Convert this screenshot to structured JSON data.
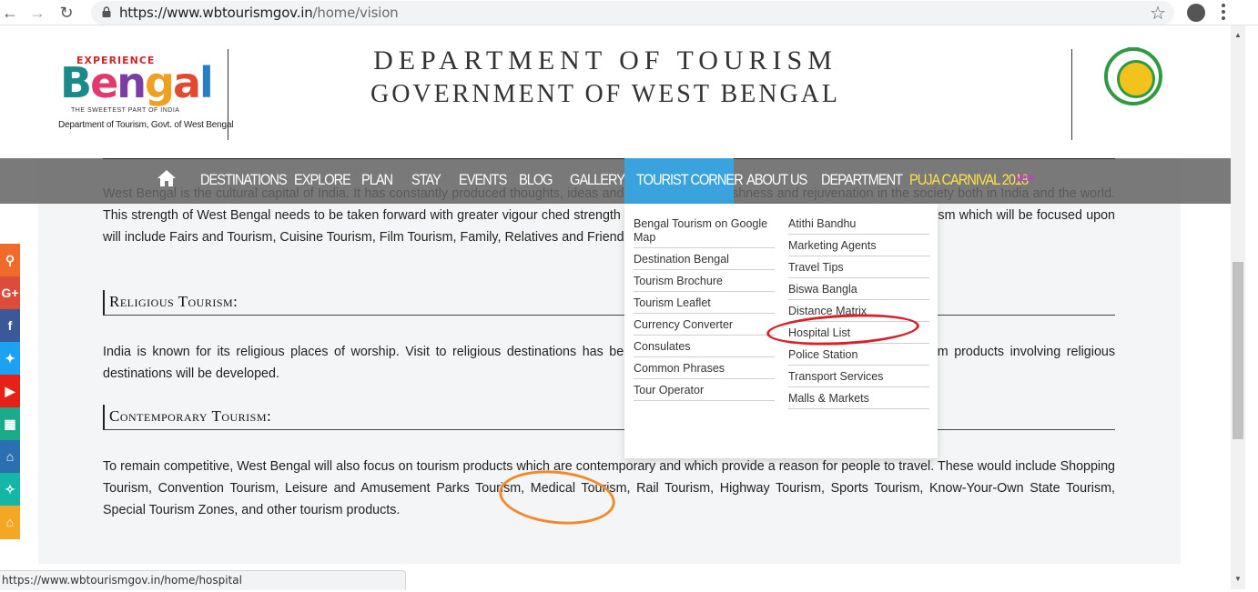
{
  "browser": {
    "url_host": "https://www.wbtourismgov.in",
    "url_path": "/home/vision",
    "status_url": "https://www.wbtourismgov.in/home/hospital"
  },
  "header": {
    "logo": {
      "top": "EXPERIENCE",
      "word": "Bengal",
      "tagline": "THE SWEETEST PART OF INDIA",
      "subtitle": "Department of Tourism, Govt. of West Bengal"
    },
    "title_line1": "DEPARTMENT OF TOURISM",
    "title_line2": "GOVERNMENT OF WEST BENGAL"
  },
  "nav": {
    "items": [
      "DESTINATIONS",
      "EXPLORE",
      "PLAN",
      "STAY",
      "EVENTS",
      "BLOG",
      "GALLERY",
      "TOURIST CORNER",
      "ABOUT US",
      "DEPARTMENT",
      "PUJA CARNIVAL 2018"
    ],
    "new_badge": "NEW",
    "active": "TOURIST CORNER"
  },
  "dropdown": {
    "left": [
      "Bengal Tourism on Google Map",
      "Destination Bengal",
      "Tourism Brochure",
      "Tourism Leaflet",
      "Currency Converter",
      "Consulates",
      "Common Phrases",
      "Tour Operator"
    ],
    "right": [
      "Atithi Bandhu",
      "Marketing Agents",
      "Travel Tips",
      "Biswa Bangla",
      "Distance Matrix",
      "Hospital List",
      "Police Station",
      "Transport Services",
      "Malls & Markets"
    ]
  },
  "content": {
    "para1": "West Bengal is the cultural capital of India. It has constantly produced thoughts, ideas and e brought forth freshness and rejuvenation in the society both in India and the world. This strength of West Bengal needs to be taken forward with greater vigour ched strength in the State. The specific components of Cultural Tourism which will be focused upon will include Fairs and Tourism, Cuisine Tourism, Film Tourism, Family, Relatives and Friends Tourism, and Village Tourism.",
    "section1": "Religious Tourism:",
    "para2": "India is known for its religious places of worship. Visit to religious destinations has been the o has a vital role to play in this area. Tourism products involving religious destinations will be developed.",
    "section2": "Contemporary Tourism:",
    "para3": "To remain competitive, West Bengal will also focus on tourism products which are contemporary and which provide a reason for people to travel. These would include Shopping Tourism, Convention Tourism, Leisure and Amusement Parks Tourism, Medical Tourism, Rail Tourism, Highway Tourism, Sports Tourism, Know-Your-Own State Tourism, Special Tourism Zones, and other tourism products."
  },
  "social": [
    {
      "icon": "search-icon",
      "glyph": "⚲",
      "color": "#f06a2a"
    },
    {
      "icon": "google-plus-icon",
      "glyph": "G+",
      "color": "#dd4b39"
    },
    {
      "icon": "facebook-icon",
      "glyph": "f",
      "color": "#3b5998"
    },
    {
      "icon": "twitter-icon",
      "glyph": "✦",
      "color": "#1da1f2"
    },
    {
      "icon": "youtube-icon",
      "glyph": "▶",
      "color": "#e62117"
    },
    {
      "icon": "calendar-icon",
      "glyph": "▦",
      "color": "#1aab8a"
    },
    {
      "icon": "temple-icon",
      "glyph": "⌂",
      "color": "#2a6fb0"
    },
    {
      "icon": "dance-icon",
      "glyph": "✧",
      "color": "#14b6a8"
    },
    {
      "icon": "building-icon",
      "glyph": "⌂",
      "color": "#f5a623"
    }
  ]
}
